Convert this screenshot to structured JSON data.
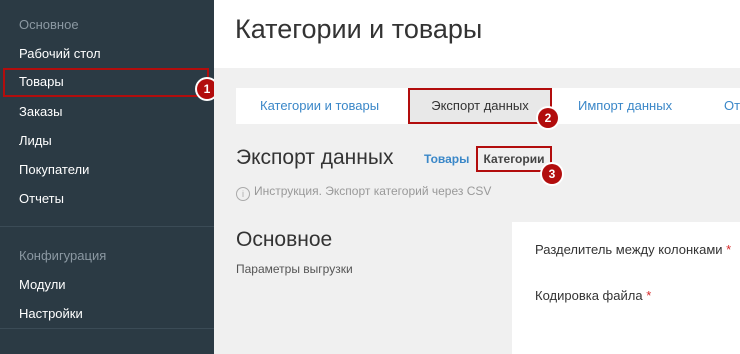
{
  "sidebar": {
    "section_main": "Основное",
    "items_main": [
      "Рабочий стол",
      "Товары",
      "Заказы",
      "Лиды",
      "Покупатели",
      "Отчеты"
    ],
    "section_config": "Конфигурация",
    "items_config": [
      "Модули",
      "Настройки"
    ]
  },
  "header": {
    "title": "Категории и товары"
  },
  "tabs": [
    "Категории и товары",
    "Экспорт данных",
    "Импорт данных",
    "От"
  ],
  "section": {
    "title": "Экспорт данных",
    "link_products": "Товары",
    "link_categories": "Категории"
  },
  "hint": {
    "text": "Инструкция. Экспорт категорий через CSV"
  },
  "group": {
    "title": "Основное",
    "subtitle": "Параметры выгрузки"
  },
  "form": {
    "separator_label": "Разделитель между колонками",
    "encoding_label": "Кодировка файла",
    "required_mark": "*"
  },
  "annotations": [
    "1",
    "2",
    "3"
  ],
  "colors": {
    "sidebar_bg": "#2b3a44",
    "accent_link": "#3a87c8",
    "highlight": "#b20d0d"
  }
}
